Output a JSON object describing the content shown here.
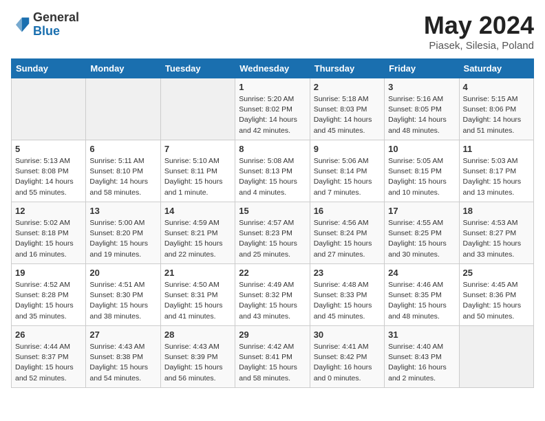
{
  "header": {
    "logo_general": "General",
    "logo_blue": "Blue",
    "title": "May 2024",
    "subtitle": "Piasek, Silesia, Poland"
  },
  "weekdays": [
    "Sunday",
    "Monday",
    "Tuesday",
    "Wednesday",
    "Thursday",
    "Friday",
    "Saturday"
  ],
  "weeks": [
    [
      {
        "day": "",
        "info": ""
      },
      {
        "day": "",
        "info": ""
      },
      {
        "day": "",
        "info": ""
      },
      {
        "day": "1",
        "info": "Sunrise: 5:20 AM\nSunset: 8:02 PM\nDaylight: 14 hours\nand 42 minutes."
      },
      {
        "day": "2",
        "info": "Sunrise: 5:18 AM\nSunset: 8:03 PM\nDaylight: 14 hours\nand 45 minutes."
      },
      {
        "day": "3",
        "info": "Sunrise: 5:16 AM\nSunset: 8:05 PM\nDaylight: 14 hours\nand 48 minutes."
      },
      {
        "day": "4",
        "info": "Sunrise: 5:15 AM\nSunset: 8:06 PM\nDaylight: 14 hours\nand 51 minutes."
      }
    ],
    [
      {
        "day": "5",
        "info": "Sunrise: 5:13 AM\nSunset: 8:08 PM\nDaylight: 14 hours\nand 55 minutes."
      },
      {
        "day": "6",
        "info": "Sunrise: 5:11 AM\nSunset: 8:10 PM\nDaylight: 14 hours\nand 58 minutes."
      },
      {
        "day": "7",
        "info": "Sunrise: 5:10 AM\nSunset: 8:11 PM\nDaylight: 15 hours\nand 1 minute."
      },
      {
        "day": "8",
        "info": "Sunrise: 5:08 AM\nSunset: 8:13 PM\nDaylight: 15 hours\nand 4 minutes."
      },
      {
        "day": "9",
        "info": "Sunrise: 5:06 AM\nSunset: 8:14 PM\nDaylight: 15 hours\nand 7 minutes."
      },
      {
        "day": "10",
        "info": "Sunrise: 5:05 AM\nSunset: 8:15 PM\nDaylight: 15 hours\nand 10 minutes."
      },
      {
        "day": "11",
        "info": "Sunrise: 5:03 AM\nSunset: 8:17 PM\nDaylight: 15 hours\nand 13 minutes."
      }
    ],
    [
      {
        "day": "12",
        "info": "Sunrise: 5:02 AM\nSunset: 8:18 PM\nDaylight: 15 hours\nand 16 minutes."
      },
      {
        "day": "13",
        "info": "Sunrise: 5:00 AM\nSunset: 8:20 PM\nDaylight: 15 hours\nand 19 minutes."
      },
      {
        "day": "14",
        "info": "Sunrise: 4:59 AM\nSunset: 8:21 PM\nDaylight: 15 hours\nand 22 minutes."
      },
      {
        "day": "15",
        "info": "Sunrise: 4:57 AM\nSunset: 8:23 PM\nDaylight: 15 hours\nand 25 minutes."
      },
      {
        "day": "16",
        "info": "Sunrise: 4:56 AM\nSunset: 8:24 PM\nDaylight: 15 hours\nand 27 minutes."
      },
      {
        "day": "17",
        "info": "Sunrise: 4:55 AM\nSunset: 8:25 PM\nDaylight: 15 hours\nand 30 minutes."
      },
      {
        "day": "18",
        "info": "Sunrise: 4:53 AM\nSunset: 8:27 PM\nDaylight: 15 hours\nand 33 minutes."
      }
    ],
    [
      {
        "day": "19",
        "info": "Sunrise: 4:52 AM\nSunset: 8:28 PM\nDaylight: 15 hours\nand 35 minutes."
      },
      {
        "day": "20",
        "info": "Sunrise: 4:51 AM\nSunset: 8:30 PM\nDaylight: 15 hours\nand 38 minutes."
      },
      {
        "day": "21",
        "info": "Sunrise: 4:50 AM\nSunset: 8:31 PM\nDaylight: 15 hours\nand 41 minutes."
      },
      {
        "day": "22",
        "info": "Sunrise: 4:49 AM\nSunset: 8:32 PM\nDaylight: 15 hours\nand 43 minutes."
      },
      {
        "day": "23",
        "info": "Sunrise: 4:48 AM\nSunset: 8:33 PM\nDaylight: 15 hours\nand 45 minutes."
      },
      {
        "day": "24",
        "info": "Sunrise: 4:46 AM\nSunset: 8:35 PM\nDaylight: 15 hours\nand 48 minutes."
      },
      {
        "day": "25",
        "info": "Sunrise: 4:45 AM\nSunset: 8:36 PM\nDaylight: 15 hours\nand 50 minutes."
      }
    ],
    [
      {
        "day": "26",
        "info": "Sunrise: 4:44 AM\nSunset: 8:37 PM\nDaylight: 15 hours\nand 52 minutes."
      },
      {
        "day": "27",
        "info": "Sunrise: 4:43 AM\nSunset: 8:38 PM\nDaylight: 15 hours\nand 54 minutes."
      },
      {
        "day": "28",
        "info": "Sunrise: 4:43 AM\nSunset: 8:39 PM\nDaylight: 15 hours\nand 56 minutes."
      },
      {
        "day": "29",
        "info": "Sunrise: 4:42 AM\nSunset: 8:41 PM\nDaylight: 15 hours\nand 58 minutes."
      },
      {
        "day": "30",
        "info": "Sunrise: 4:41 AM\nSunset: 8:42 PM\nDaylight: 16 hours\nand 0 minutes."
      },
      {
        "day": "31",
        "info": "Sunrise: 4:40 AM\nSunset: 8:43 PM\nDaylight: 16 hours\nand 2 minutes."
      },
      {
        "day": "",
        "info": ""
      }
    ]
  ]
}
